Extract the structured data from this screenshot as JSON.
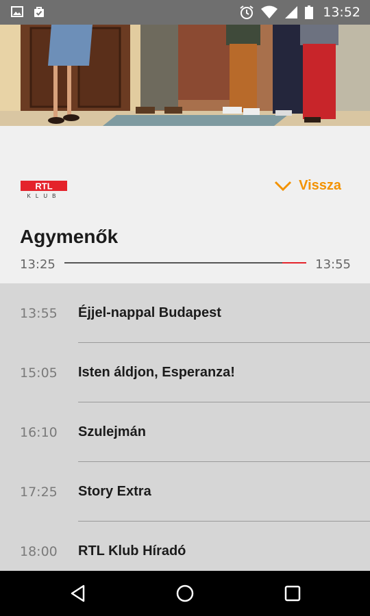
{
  "status_bar": {
    "time": "13:52",
    "icons": [
      "image-icon",
      "bag-check-icon",
      "alarm-icon",
      "wifi-icon",
      "signal-icon",
      "battery-icon"
    ]
  },
  "hero": {
    "description_icon": "tv-show-hero-image"
  },
  "channel": {
    "logo_text": "RTL",
    "logo_subtext": "KLUB",
    "logo_color": "#e4232b"
  },
  "back_button": {
    "label": "Vissza",
    "icon": "chevron-down-icon",
    "color": "#f39200"
  },
  "current_program": {
    "title": "Agymenők",
    "start": "13:25",
    "end": "13:55",
    "progress": 0.9
  },
  "schedule": [
    {
      "time": "13:55",
      "title": "Éjjel-nappal Budapest"
    },
    {
      "time": "15:05",
      "title": "Isten áldjon, Esperanza!"
    },
    {
      "time": "16:10",
      "title": "Szulejmán"
    },
    {
      "time": "17:25",
      "title": "Story Extra"
    },
    {
      "time": "18:00",
      "title": "RTL Klub Híradó"
    }
  ],
  "nav": [
    "back-nav-icon",
    "home-nav-icon",
    "recents-nav-icon"
  ]
}
